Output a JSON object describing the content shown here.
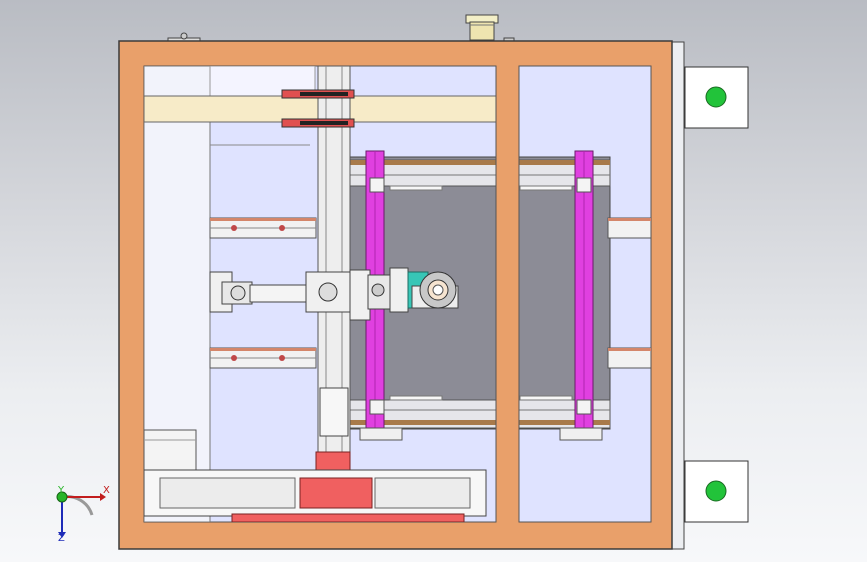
{
  "viewport": {
    "background_top": "#b9bcc3",
    "background_bottom": "#f7f8fa"
  },
  "frame": {
    "color": "#e9a06a",
    "outline": "#3b3b3b",
    "window_fill": "#dfe3ff"
  },
  "colors": {
    "rail_magenta": "#e040e0",
    "rail_pink_cap": "#ff9ed0",
    "block_red": "#f06060",
    "beam_cream": "#f7ebc8",
    "teal_mount": "#37c6b6",
    "grid_gray": "#8c8c96",
    "button_green": "#22c33a"
  },
  "triad": {
    "x_label": "X",
    "y_label": "Y",
    "z_label": "Z",
    "x_color": "#c21d1d",
    "y_color": "#28b428",
    "z_color": "#1d2bb8"
  },
  "icons": {
    "right_tab_top": "green-dot-icon",
    "right_tab_bottom": "green-dot-icon",
    "top_knob": "cylinder-knob-icon"
  }
}
